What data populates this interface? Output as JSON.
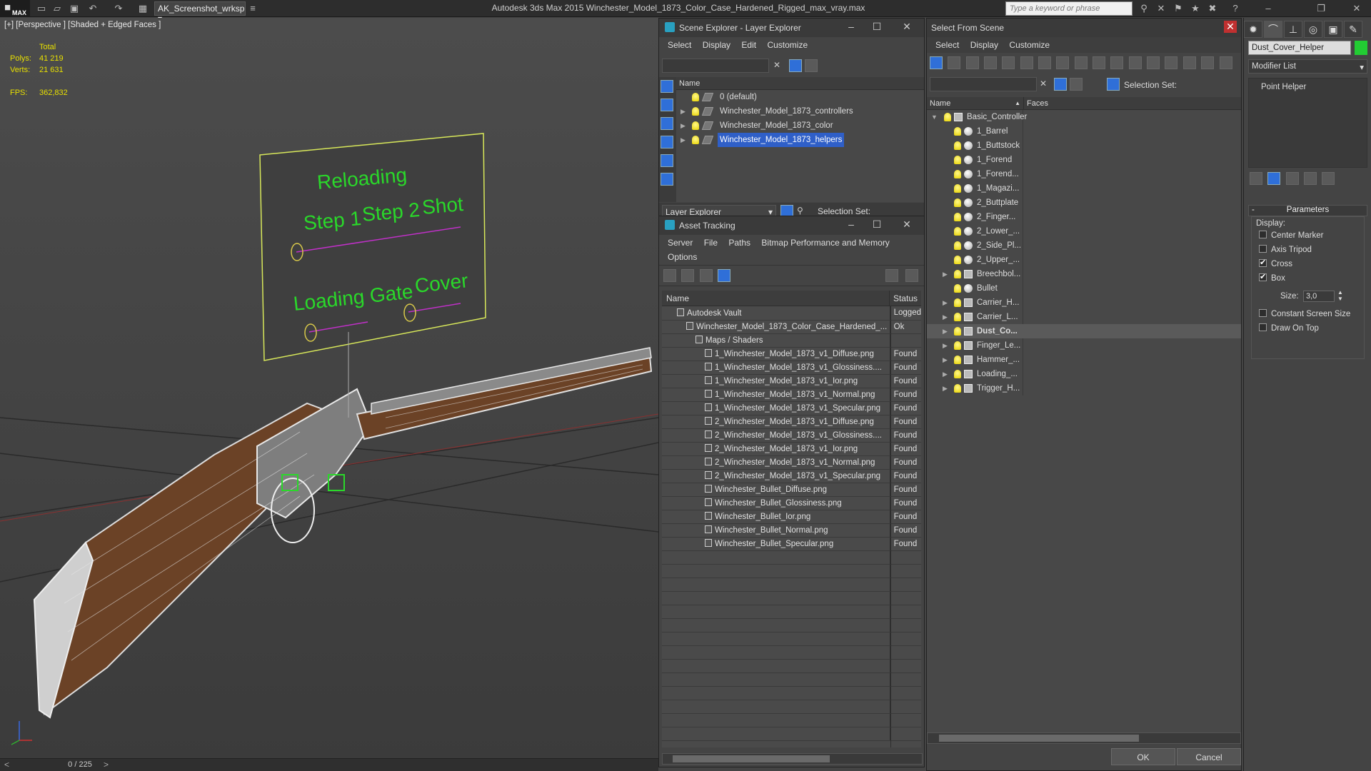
{
  "app": {
    "title": "Autodesk 3ds Max  2015    Winchester_Model_1873_Color_Case_Hardened_Rigged_max_vray.max",
    "logo": "MAX",
    "workspace": "AK_Screenshot_wrksp",
    "search_placeholder": "Type a keyword or phrase"
  },
  "viewport": {
    "label": "[+] [Perspective ] [Shaded + Edged Faces ]",
    "stats_header": "Total",
    "polys_label": "Polys:",
    "polys_value": "41 219",
    "verts_label": "Verts:",
    "verts_value": "21 631",
    "fps_label": "FPS:",
    "fps_value": "362,832",
    "board_texts": [
      "Reloading",
      "Step 1",
      "Step 2",
      "Shot",
      "Loading Gate",
      "Cover"
    ],
    "frame_counter": "0 / 225"
  },
  "scene_explorer": {
    "title": "Scene Explorer - Layer Explorer",
    "menu": [
      "Select",
      "Display",
      "Edit",
      "Customize"
    ],
    "column_name": "Name",
    "layers": [
      {
        "label": "0 (default)",
        "expandable": false,
        "selected": false
      },
      {
        "label": "Winchester_Model_1873_controllers",
        "expandable": true,
        "selected": false
      },
      {
        "label": "Winchester_Model_1873_color",
        "expandable": true,
        "selected": false
      },
      {
        "label": "Winchester_Model_1873_helpers",
        "expandable": true,
        "selected": true
      }
    ],
    "footer_dropdown": "Layer Explorer",
    "selection_set_label": "Selection Set:"
  },
  "asset_tracking": {
    "title": "Asset Tracking",
    "menu": [
      "Server",
      "File",
      "Paths",
      "Bitmap Performance and Memory"
    ],
    "menu2": [
      "Options"
    ],
    "col_name": "Name",
    "col_status": "Status",
    "rows": [
      {
        "indent": 1,
        "name": "Autodesk Vault",
        "status": "Logged"
      },
      {
        "indent": 2,
        "name": "Winchester_Model_1873_Color_Case_Hardened_...",
        "status": "Ok"
      },
      {
        "indent": 3,
        "name": "Maps / Shaders",
        "status": ""
      },
      {
        "indent": 4,
        "name": "1_Winchester_Model_1873_v1_Diffuse.png",
        "status": "Found"
      },
      {
        "indent": 4,
        "name": "1_Winchester_Model_1873_v1_Glossiness....",
        "status": "Found"
      },
      {
        "indent": 4,
        "name": "1_Winchester_Model_1873_v1_Ior.png",
        "status": "Found"
      },
      {
        "indent": 4,
        "name": "1_Winchester_Model_1873_v1_Normal.png",
        "status": "Found"
      },
      {
        "indent": 4,
        "name": "1_Winchester_Model_1873_v1_Specular.png",
        "status": "Found"
      },
      {
        "indent": 4,
        "name": "2_Winchester_Model_1873_v1_Diffuse.png",
        "status": "Found"
      },
      {
        "indent": 4,
        "name": "2_Winchester_Model_1873_v1_Glossiness....",
        "status": "Found"
      },
      {
        "indent": 4,
        "name": "2_Winchester_Model_1873_v1_Ior.png",
        "status": "Found"
      },
      {
        "indent": 4,
        "name": "2_Winchester_Model_1873_v1_Normal.png",
        "status": "Found"
      },
      {
        "indent": 4,
        "name": "2_Winchester_Model_1873_v1_Specular.png",
        "status": "Found"
      },
      {
        "indent": 4,
        "name": "Winchester_Bullet_Diffuse.png",
        "status": "Found"
      },
      {
        "indent": 4,
        "name": "Winchester_Bullet_Glossiness.png",
        "status": "Found"
      },
      {
        "indent": 4,
        "name": "Winchester_Bullet_Ior.png",
        "status": "Found"
      },
      {
        "indent": 4,
        "name": "Winchester_Bullet_Normal.png",
        "status": "Found"
      },
      {
        "indent": 4,
        "name": "Winchester_Bullet_Specular.png",
        "status": "Found"
      }
    ]
  },
  "select_from_scene": {
    "title": "Select From Scene",
    "menu": [
      "Select",
      "Display",
      "Customize"
    ],
    "selection_set_label": "Selection Set:",
    "col_name": "Name",
    "col_faces": "Faces",
    "items": [
      {
        "label": "Basic_Controller",
        "level": 0,
        "expand": "open",
        "kind": "group",
        "selected": false
      },
      {
        "label": "1_Barrel",
        "level": 1,
        "expand": "",
        "kind": "obj",
        "selected": false
      },
      {
        "label": "1_Buttstock",
        "level": 1,
        "expand": "",
        "kind": "obj",
        "selected": false
      },
      {
        "label": "1_Forend",
        "level": 1,
        "expand": "",
        "kind": "obj",
        "selected": false
      },
      {
        "label": "1_Forend...",
        "level": 1,
        "expand": "",
        "kind": "obj",
        "selected": false
      },
      {
        "label": "1_Magazi...",
        "level": 1,
        "expand": "",
        "kind": "obj",
        "selected": false
      },
      {
        "label": "2_Buttplate",
        "level": 1,
        "expand": "",
        "kind": "obj",
        "selected": false
      },
      {
        "label": "2_Finger...",
        "level": 1,
        "expand": "",
        "kind": "obj",
        "selected": false
      },
      {
        "label": "2_Lower_...",
        "level": 1,
        "expand": "",
        "kind": "obj",
        "selected": false
      },
      {
        "label": "2_Side_Pl...",
        "level": 1,
        "expand": "",
        "kind": "obj",
        "selected": false
      },
      {
        "label": "2_Upper_...",
        "level": 1,
        "expand": "",
        "kind": "obj",
        "selected": false
      },
      {
        "label": "Breechbol...",
        "level": 1,
        "expand": "closed",
        "kind": "group",
        "selected": false
      },
      {
        "label": "Bullet",
        "level": 1,
        "expand": "",
        "kind": "obj",
        "selected": false
      },
      {
        "label": "Carrier_H...",
        "level": 1,
        "expand": "closed",
        "kind": "group",
        "selected": false
      },
      {
        "label": "Carrier_L...",
        "level": 1,
        "expand": "closed",
        "kind": "group",
        "selected": false
      },
      {
        "label": "Dust_Co...",
        "level": 1,
        "expand": "closed",
        "kind": "group",
        "selected": true
      },
      {
        "label": "Finger_Le...",
        "level": 1,
        "expand": "closed",
        "kind": "group",
        "selected": false
      },
      {
        "label": "Hammer_...",
        "level": 1,
        "expand": "closed",
        "kind": "group",
        "selected": false
      },
      {
        "label": "Loading_...",
        "level": 1,
        "expand": "closed",
        "kind": "group",
        "selected": false
      },
      {
        "label": "Trigger_H...",
        "level": 1,
        "expand": "closed",
        "kind": "group",
        "selected": false
      }
    ],
    "ok_label": "OK",
    "cancel_label": "Cancel"
  },
  "command_panel": {
    "object_name": "Dust_Cover_Helper",
    "object_color": "#22cc33",
    "modifier_list": "Modifier List",
    "stack_item": "Point Helper",
    "rollout_title": "Parameters",
    "rollout_toggle": "-",
    "display_label": "Display:",
    "options": [
      {
        "label": "Center Marker",
        "checked": false
      },
      {
        "label": "Axis Tripod",
        "checked": false
      },
      {
        "label": "Cross",
        "checked": true
      },
      {
        "label": "Box",
        "checked": true
      }
    ],
    "size_label": "Size:",
    "size_value": "3,0",
    "options2": [
      {
        "label": "Constant Screen Size",
        "checked": false
      },
      {
        "label": "Draw On Top",
        "checked": false
      }
    ]
  }
}
